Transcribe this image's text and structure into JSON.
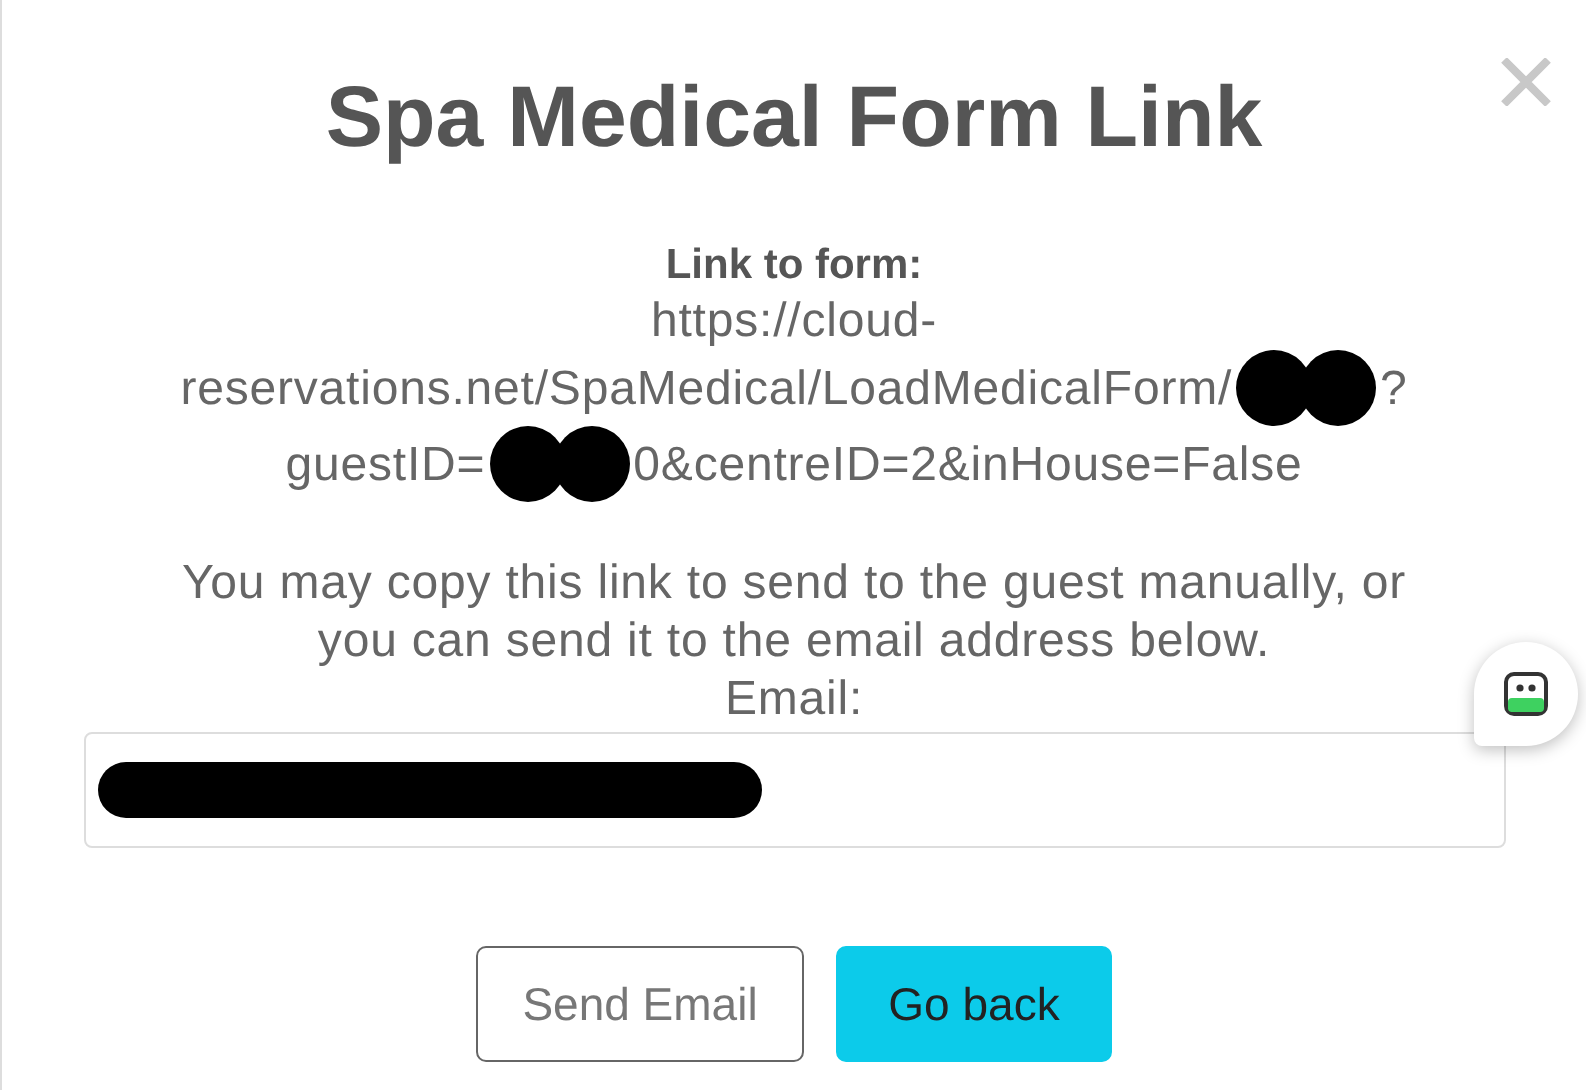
{
  "dialog": {
    "title": "Spa Medical Form Link",
    "link_label": "Link to form:",
    "link_lines": [
      [
        {
          "kind": "text",
          "text": "https://cloud-"
        }
      ],
      [
        {
          "kind": "text",
          "text": "reservations.net/SpaMedical/LoadMedicalForm/"
        },
        {
          "kind": "redaction"
        },
        {
          "kind": "text",
          "text": "?"
        }
      ],
      [
        {
          "kind": "text",
          "text": "guestID="
        },
        {
          "kind": "redaction"
        },
        {
          "kind": "text",
          "text": "0&centreID=2&inHouse=False"
        }
      ]
    ],
    "message_lines": [
      "You may copy this link to send to the guest manually, or",
      "you can send it to the email address below."
    ],
    "email": {
      "label": "Email:",
      "redacted": true
    },
    "buttons": [
      {
        "label": "Send Email",
        "kind": "secondary"
      },
      {
        "label": "Go back",
        "kind": "primary"
      }
    ]
  }
}
